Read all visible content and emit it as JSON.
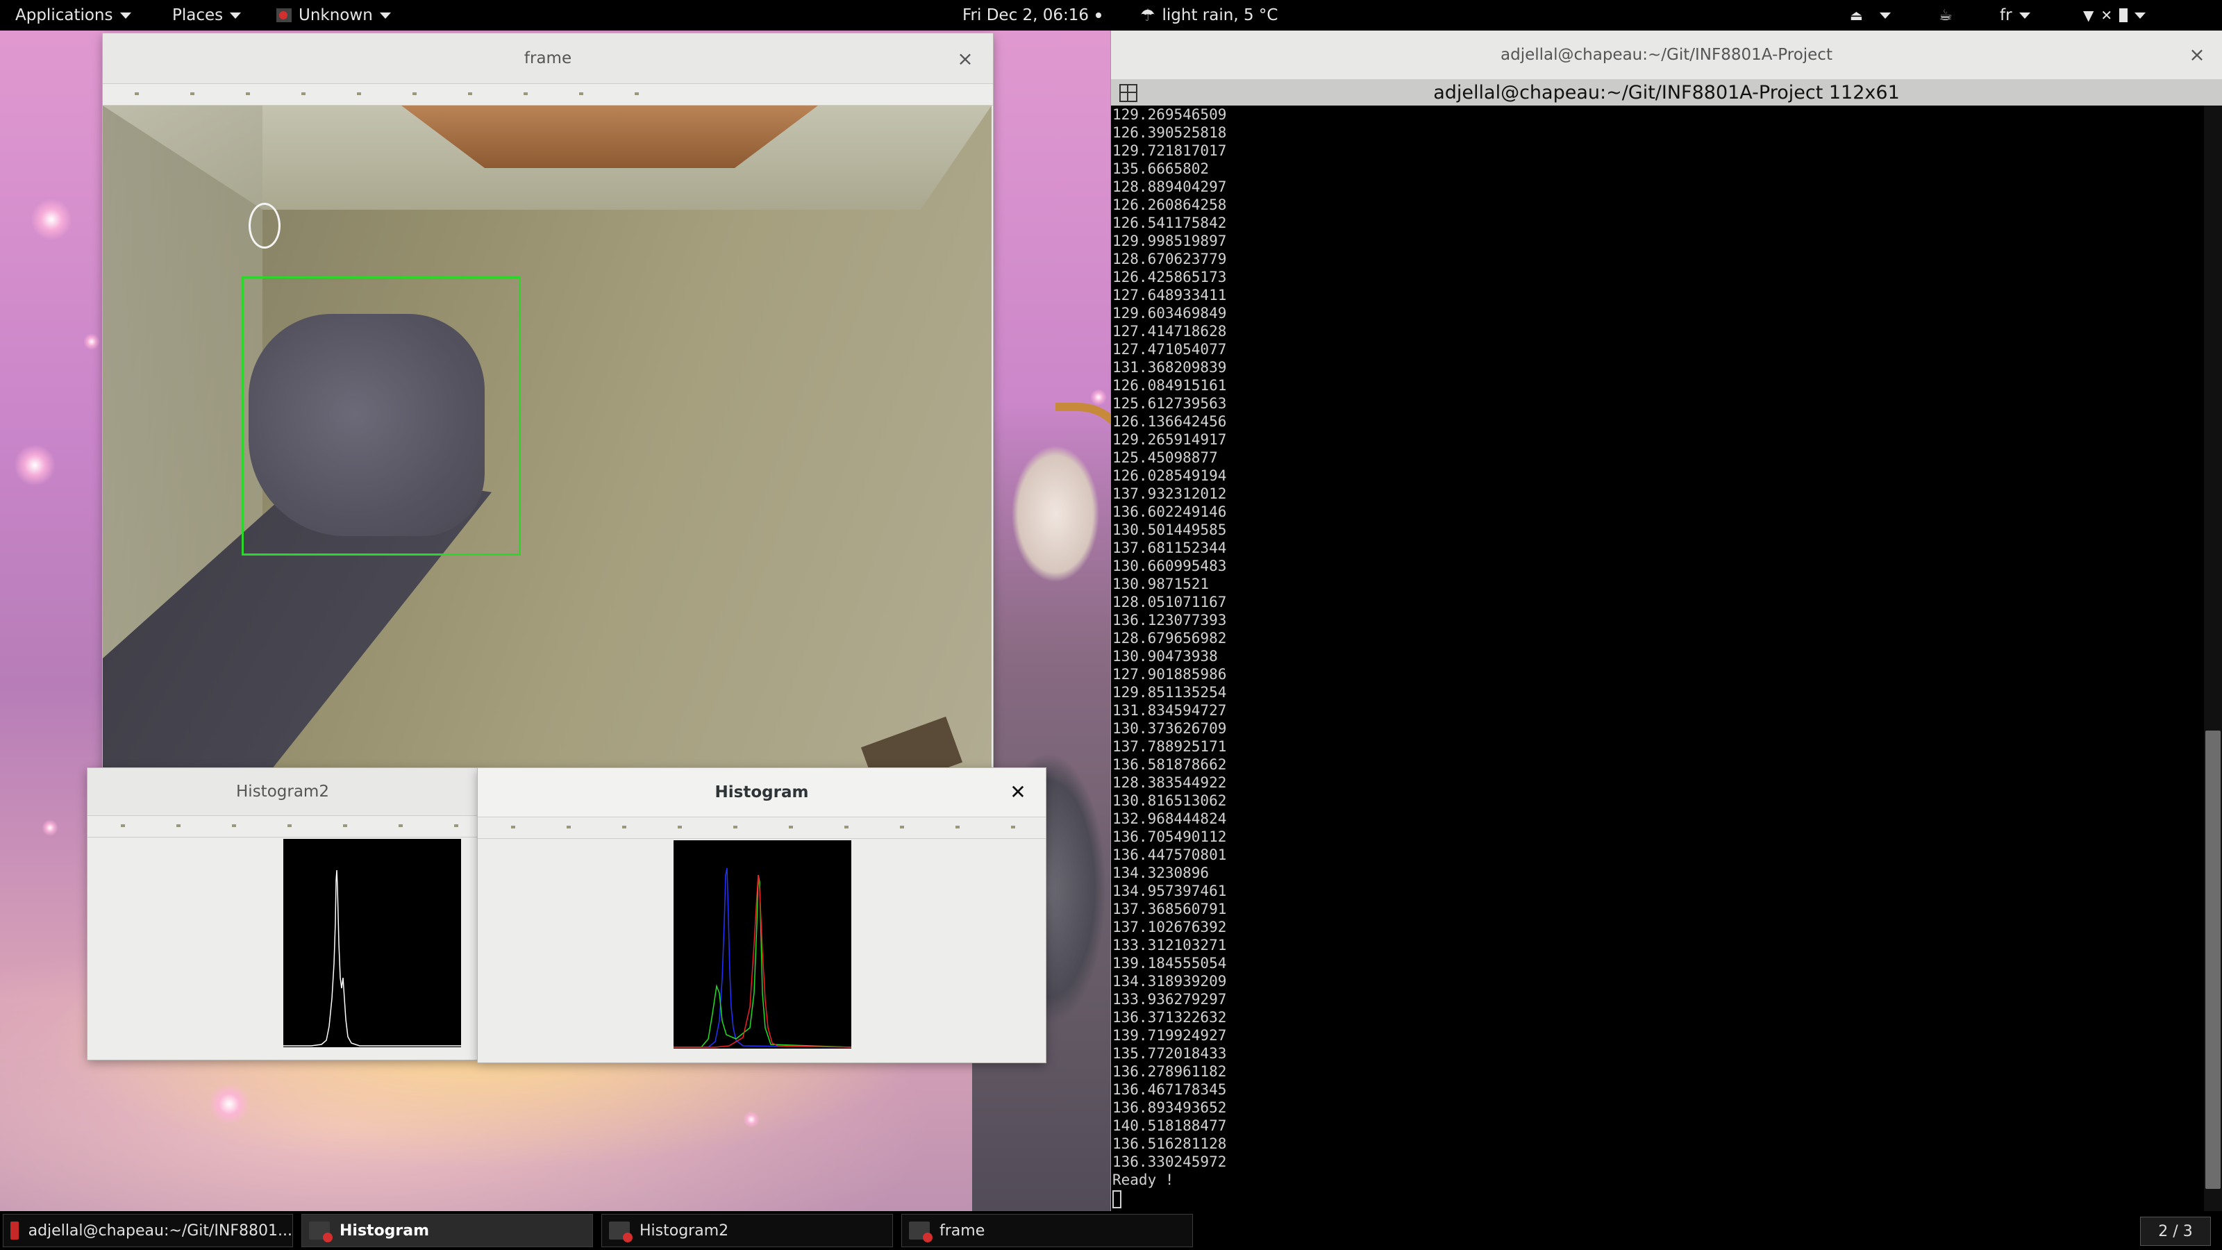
{
  "top_panel": {
    "applications": "Applications",
    "places": "Places",
    "app_menu": "Unknown",
    "clock": "Fri Dec  2, 06:16",
    "weather": "light rain, 5 °C",
    "keyboard_layout": "fr"
  },
  "windows": {
    "frame": {
      "title": "frame",
      "close": "×"
    },
    "histogram2": {
      "title": "Histogram2"
    },
    "histogram": {
      "title": "Histogram",
      "close": "✕"
    },
    "terminal": {
      "title": "adjellal@chapeau:~/Git/INF8801A-Project",
      "tab_title": "adjellal@chapeau:~/Git/INF8801A-Project 112x61",
      "close": "×",
      "lines": [
        "129.269546509",
        "126.390525818",
        "129.721817017",
        "135.6665802",
        "128.889404297",
        "126.260864258",
        "126.541175842",
        "129.998519897",
        "128.670623779",
        "126.425865173",
        "127.648933411",
        "129.603469849",
        "127.414718628",
        "127.471054077",
        "131.368209839",
        "126.084915161",
        "125.612739563",
        "126.136642456",
        "129.265914917",
        "125.45098877",
        "126.028549194",
        "137.932312012",
        "136.602249146",
        "130.501449585",
        "137.681152344",
        "130.660995483",
        "130.9871521",
        "128.051071167",
        "136.123077393",
        "128.679656982",
        "130.90473938",
        "127.901885986",
        "129.851135254",
        "131.834594727",
        "130.373626709",
        "137.788925171",
        "136.581878662",
        "128.383544922",
        "130.816513062",
        "132.968444824",
        "136.705490112",
        "136.447570801",
        "134.3230896",
        "134.957397461",
        "137.368560791",
        "137.102676392",
        "133.312103271",
        "139.184555054",
        "134.318939209",
        "133.936279297",
        "136.371322632",
        "139.719924927",
        "135.772018433",
        "136.278961182",
        "136.467178345",
        "136.893493652",
        "140.518188477",
        "136.516281128",
        "136.330245972",
        "Ready !"
      ]
    }
  },
  "taskbar": {
    "items": [
      {
        "label": "adjellal@chapeau:~/Git/INF8801..."
      },
      {
        "label": "Histogram"
      },
      {
        "label": "Histogram2"
      },
      {
        "label": "frame"
      }
    ],
    "workspace": "2 / 3"
  },
  "colors": {
    "detection_box": "#2bd72b",
    "terminal_bg": "#000000",
    "terminal_fg": "#d2d2d2",
    "hist_blue": "#2233ff",
    "hist_green": "#22dd22",
    "hist_red": "#ee2222",
    "hist_gray": "#ffffff"
  }
}
